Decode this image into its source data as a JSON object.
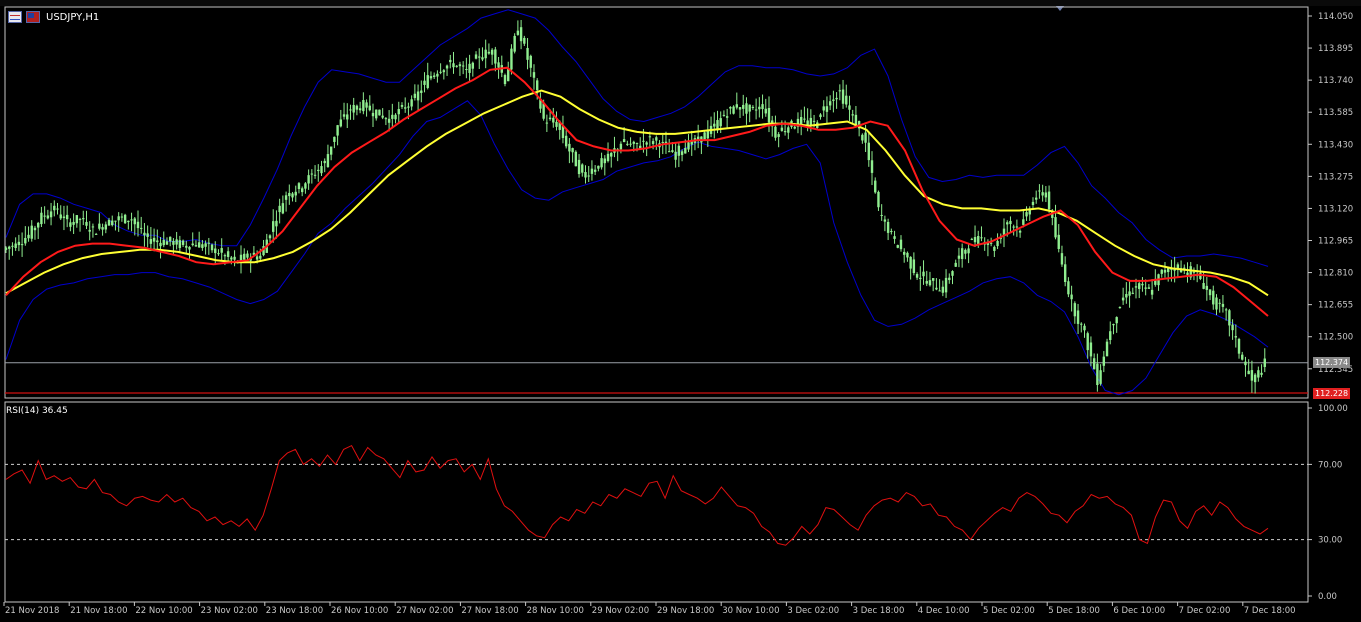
{
  "chart_title": "USDJPY,H1",
  "rsi_label": "RSI(14) 36.45",
  "price_badges": {
    "current": "112.374",
    "low_line": "112.228"
  },
  "colors": {
    "background": "#000000",
    "axis": "#c8c8c8",
    "candle": "#90ee90",
    "bollinger": "#0000cd",
    "ma_fast": "#ff1a1a",
    "ma_slow": "#ffff33",
    "rsi": "#e01010",
    "level_line": "#9aa0a8",
    "red_line": "#d01010"
  },
  "icons": [
    "chart-table-icon",
    "symbol-flag-icon",
    "scroll-marker-icon"
  ],
  "chart_data": [
    {
      "type": "line",
      "title": "USDJPY,H1",
      "series": [
        {
          "name": "",
          "kind": "price",
          "y": [
            112.92,
            112.95,
            112.99,
            113.08,
            113.12,
            113.05,
            113.07,
            113.01,
            113.05,
            113.07,
            113.07,
            112.98,
            112.96,
            112.96,
            112.94,
            112.95,
            112.93,
            112.9,
            112.86,
            112.89,
            112.89,
            113.05,
            113.19,
            113.22,
            113.28,
            113.34,
            113.52,
            113.6,
            113.62,
            113.58,
            113.55,
            113.6,
            113.65,
            113.75,
            113.8,
            113.82,
            113.78,
            113.86,
            113.88,
            113.74,
            114.0,
            113.79,
            113.55,
            113.53,
            113.4,
            113.28,
            113.32,
            113.36,
            113.44,
            113.42,
            113.45,
            113.44,
            113.38,
            113.42,
            113.45,
            113.5,
            113.57,
            113.62,
            113.59,
            113.62,
            113.48,
            113.52,
            113.54,
            113.53,
            113.63,
            113.68,
            113.56,
            113.43,
            113.11,
            112.99,
            112.9,
            112.8,
            112.76,
            112.73,
            112.86,
            112.95,
            112.98,
            112.93,
            113.06,
            113.02,
            113.17,
            113.2,
            112.91,
            112.66,
            112.51,
            112.29,
            112.54,
            112.69,
            112.74,
            112.72,
            112.81,
            112.84,
            112.82,
            112.78,
            112.67,
            112.61,
            112.43,
            112.28,
            112.37
          ]
        },
        {
          "name": "",
          "kind": "bollinger-upper",
          "y": [
            112.98,
            113.14,
            113.19,
            113.19,
            113.17,
            113.14,
            113.12,
            113.1,
            113.04,
            113.01,
            112.99,
            112.99,
            112.96,
            112.96,
            112.97,
            112.95,
            112.94,
            112.94,
            113.04,
            113.17,
            113.31,
            113.47,
            113.61,
            113.73,
            113.79,
            113.78,
            113.77,
            113.75,
            113.73,
            113.73,
            113.79,
            113.85,
            113.91,
            113.95,
            113.99,
            114.04,
            114.06,
            114.08,
            114.06,
            114.04,
            113.98,
            113.9,
            113.83,
            113.74,
            113.65,
            113.59,
            113.55,
            113.54,
            113.56,
            113.58,
            113.61,
            113.66,
            113.72,
            113.78,
            113.81,
            113.81,
            113.8,
            113.8,
            113.79,
            113.77,
            113.76,
            113.77,
            113.8,
            113.86,
            113.89,
            113.76,
            113.55,
            113.37,
            113.27,
            113.25,
            113.26,
            113.28,
            113.27,
            113.28,
            113.28,
            113.28,
            113.33,
            113.39,
            113.42,
            113.34,
            113.23,
            113.17,
            113.1,
            113.05,
            112.97,
            112.92,
            112.88,
            112.89,
            112.89,
            112.9,
            112.89,
            112.88,
            112.86,
            112.84
          ]
        },
        {
          "name": "",
          "kind": "bollinger-lower",
          "y": [
            112.39,
            112.58,
            112.68,
            112.73,
            112.75,
            112.76,
            112.78,
            112.79,
            112.8,
            112.8,
            112.81,
            112.81,
            112.79,
            112.78,
            112.76,
            112.74,
            112.71,
            112.68,
            112.66,
            112.68,
            112.72,
            112.81,
            112.9,
            113.0,
            113.05,
            113.12,
            113.18,
            113.24,
            113.31,
            113.38,
            113.47,
            113.54,
            113.56,
            113.6,
            113.64,
            113.57,
            113.43,
            113.31,
            113.21,
            113.17,
            113.16,
            113.2,
            113.22,
            113.24,
            113.26,
            113.3,
            113.32,
            113.34,
            113.35,
            113.37,
            113.41,
            113.44,
            113.42,
            113.41,
            113.4,
            113.38,
            113.36,
            113.38,
            113.41,
            113.43,
            113.34,
            113.05,
            112.86,
            112.7,
            112.58,
            112.55,
            112.56,
            112.59,
            112.63,
            112.66,
            112.69,
            112.72,
            112.76,
            112.78,
            112.79,
            112.76,
            112.7,
            112.67,
            112.62,
            112.5,
            112.35,
            112.24,
            112.22,
            112.24,
            112.3,
            112.41,
            112.52,
            112.6,
            112.63,
            112.61,
            112.58,
            112.54,
            112.5,
            112.45
          ]
        },
        {
          "name": "",
          "kind": "ma-fast",
          "y": [
            112.7,
            112.79,
            112.86,
            112.91,
            112.94,
            112.95,
            112.95,
            112.94,
            112.93,
            112.91,
            112.89,
            112.86,
            112.85,
            112.86,
            112.87,
            112.93,
            113.01,
            113.12,
            113.23,
            113.32,
            113.39,
            113.44,
            113.49,
            113.55,
            113.6,
            113.65,
            113.7,
            113.74,
            113.79,
            113.8,
            113.73,
            113.64,
            113.54,
            113.45,
            113.42,
            113.4,
            113.4,
            113.41,
            113.43,
            113.44,
            113.45,
            113.45,
            113.47,
            113.49,
            113.52,
            113.53,
            113.52,
            113.5,
            113.5,
            113.51,
            113.54,
            113.52,
            113.4,
            113.21,
            113.06,
            112.97,
            112.94,
            112.96,
            113.0,
            113.04,
            113.08,
            113.11,
            113.04,
            112.91,
            112.81,
            112.77,
            112.77,
            112.78,
            112.79,
            112.8,
            112.79,
            112.74,
            112.67,
            112.6
          ]
        },
        {
          "name": "",
          "kind": "ma-slow",
          "y": [
            112.71,
            112.76,
            112.81,
            112.85,
            112.88,
            112.9,
            112.91,
            112.92,
            112.92,
            112.91,
            112.89,
            112.87,
            112.86,
            112.86,
            112.88,
            112.91,
            112.96,
            113.02,
            113.1,
            113.19,
            113.28,
            113.35,
            113.42,
            113.48,
            113.53,
            113.58,
            113.62,
            113.66,
            113.69,
            113.66,
            113.6,
            113.55,
            113.51,
            113.49,
            113.48,
            113.48,
            113.49,
            113.5,
            113.51,
            113.52,
            113.53,
            113.53,
            113.52,
            113.53,
            113.54,
            113.5,
            113.4,
            113.28,
            113.18,
            113.14,
            113.12,
            113.12,
            113.11,
            113.11,
            113.12,
            113.1,
            113.06,
            113.0,
            112.94,
            112.89,
            112.85,
            112.83,
            112.82,
            112.81,
            112.79,
            112.76,
            112.7
          ]
        }
      ],
      "ylim": [
        112.228,
        114.05
      ],
      "yticks": [
        "114.050",
        "113.895",
        "113.740",
        "113.585",
        "113.430",
        "113.275",
        "113.120",
        "112.965",
        "112.810",
        "112.655",
        "112.500",
        "112.345"
      ],
      "xticks": [
        "21 Nov 2018",
        "21 Nov 18:00",
        "22 Nov 10:00",
        "23 Nov 02:00",
        "23 Nov 18:00",
        "26 Nov 10:00",
        "27 Nov 02:00",
        "27 Nov 18:00",
        "28 Nov 10:00",
        "29 Nov 02:00",
        "29 Nov 18:00",
        "30 Nov 10:00",
        "3 Dec 02:00",
        "3 Dec 18:00",
        "4 Dec 10:00",
        "5 Dec 02:00",
        "5 Dec 18:00",
        "6 Dec 10:00",
        "7 Dec 02:00",
        "7 Dec 18:00"
      ],
      "horizontal_lines": [
        112.374,
        112.228
      ]
    },
    {
      "type": "line",
      "title": "RSI(14) 36.45",
      "series": [
        {
          "name": "",
          "y": [
            62,
            65,
            67,
            60,
            72,
            62,
            64,
            61,
            63,
            58,
            57,
            62,
            55,
            54,
            50,
            48,
            52,
            53,
            51,
            50,
            54,
            50,
            52,
            47,
            45,
            40,
            42,
            38,
            40,
            37,
            41,
            35,
            43,
            57,
            72,
            76,
            78,
            70,
            73,
            69,
            75,
            70,
            78,
            80,
            72,
            79,
            75,
            73,
            68,
            63,
            72,
            66,
            67,
            74,
            68,
            72,
            73,
            66,
            70,
            62,
            73,
            57,
            48,
            45,
            40,
            35,
            32,
            31,
            38,
            42,
            40,
            46,
            44,
            50,
            48,
            54,
            52,
            57,
            55,
            53,
            60,
            61,
            52,
            64,
            56,
            54,
            52,
            49,
            52,
            58,
            53,
            48,
            47,
            44,
            37,
            34,
            28,
            27,
            31,
            37,
            33,
            38,
            47,
            46,
            42,
            38,
            35,
            43,
            48,
            51,
            52,
            50,
            55,
            53,
            48,
            49,
            43,
            42,
            37,
            35,
            30,
            36,
            40,
            44,
            47,
            45,
            52,
            55,
            53,
            49,
            44,
            43,
            39,
            45,
            48,
            54,
            52,
            53,
            49,
            47,
            43,
            30,
            28,
            42,
            51,
            50,
            40,
            36,
            45,
            48,
            43,
            50,
            47,
            41,
            37,
            35,
            33,
            36
          ],
          "levels": [
            70,
            30
          ]
        }
      ],
      "ylim": [
        0,
        100
      ],
      "yticks": [
        "100.00",
        "70.00",
        "30.00",
        "0.00"
      ]
    }
  ]
}
